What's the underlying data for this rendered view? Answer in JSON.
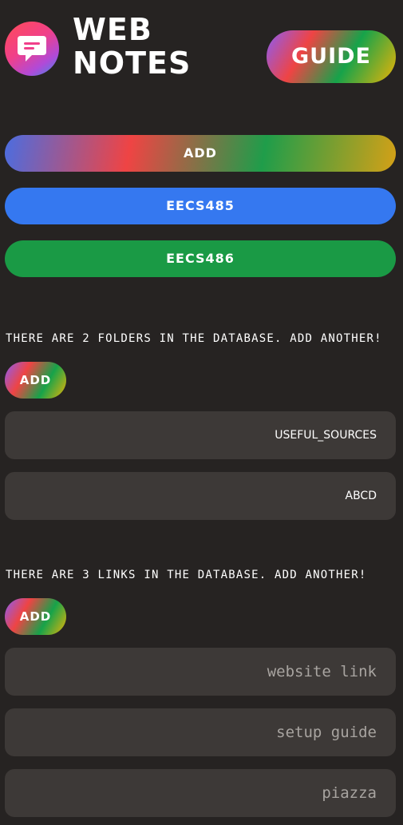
{
  "header": {
    "title_line1": "WEB",
    "title_line2": "NOTES",
    "logo_icon": "chat-bubble-icon",
    "guide_label": "GUIDE"
  },
  "main_buttons": {
    "add_label": "ADD",
    "courses": [
      {
        "label": "EECS485",
        "color": "#3578f0"
      },
      {
        "label": "EECS486",
        "color": "#1a9a45"
      }
    ]
  },
  "folders": {
    "info": "THERE ARE 2 FOLDERS IN THE DATABASE. ADD ANOTHER!",
    "add_label": "ADD",
    "items": [
      {
        "label": "USEFUL_SOURCES"
      },
      {
        "label": "ABCD"
      }
    ]
  },
  "links": {
    "info": "THERE ARE 3 LINKS IN THE DATABASE. ADD ANOTHER!",
    "add_label": "ADD",
    "items": [
      {
        "label": "website link"
      },
      {
        "label": "setup guide"
      },
      {
        "label": "piazza"
      }
    ]
  },
  "colors": {
    "background": "#262322",
    "card": "#3d3937",
    "muted_text": "#a8a4a0"
  }
}
